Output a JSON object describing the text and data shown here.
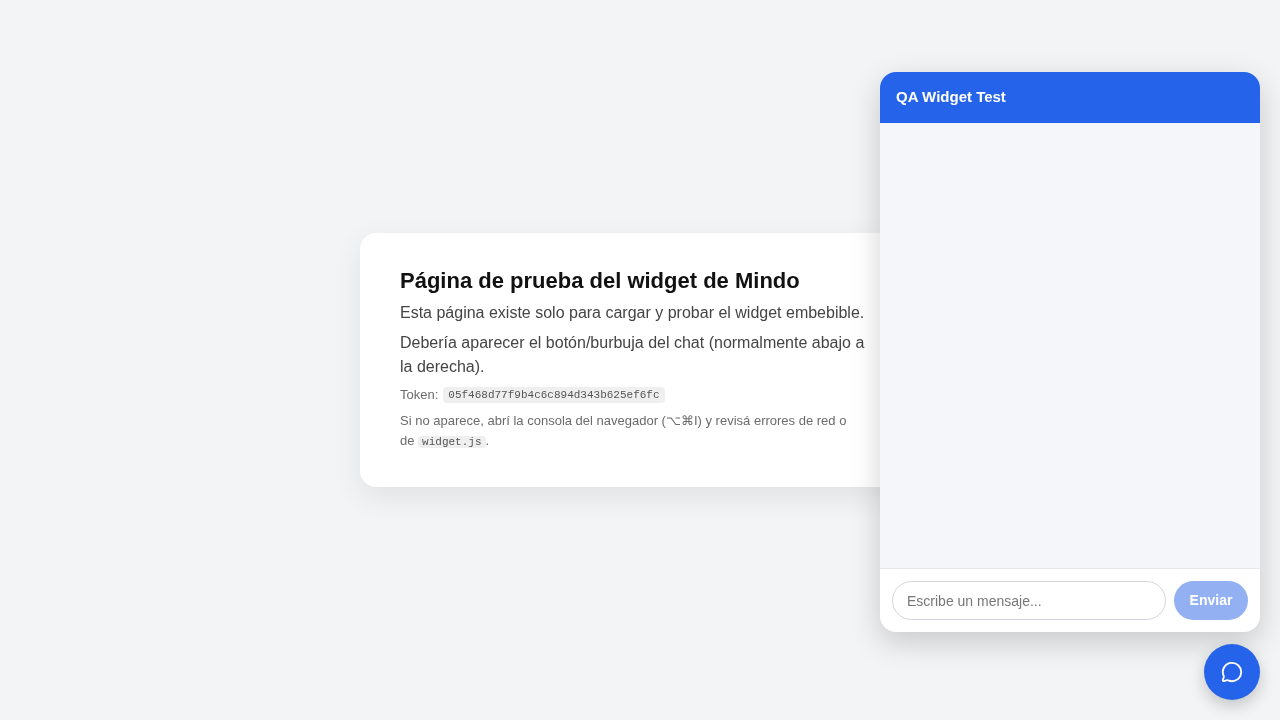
{
  "page": {
    "heading": "Página de prueba del widget de Mindo",
    "paragraphs": [
      "Esta página existe solo para cargar y probar el widget embebible.",
      "Debería aparecer el botón/burbuja del chat (normalmente abajo a la derecha)."
    ],
    "token": {
      "label": "Token:",
      "value": "05f468d77f9b4c6c894d343b625ef6fc"
    },
    "note": {
      "before": "Si no aparece, abrí la consola del navegador (⌥⌘I) y revisá errores de red o de",
      "code": "widget.js",
      "after": "."
    }
  },
  "chat_widget": {
    "title": "QA Widget Test",
    "input": {
      "placeholder": "Escribe un mensaje..."
    },
    "send_button": {
      "label": "Enviar",
      "disabled": true
    }
  }
}
